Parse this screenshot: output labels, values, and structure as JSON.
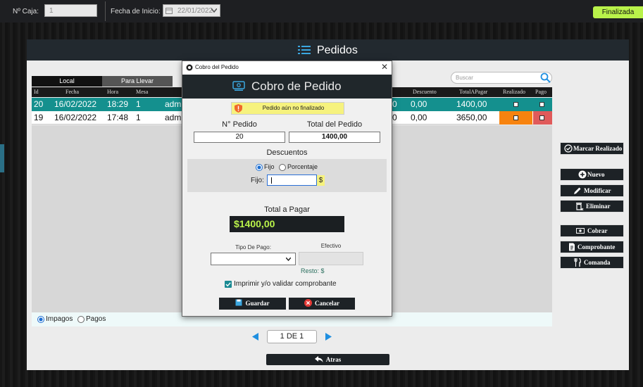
{
  "topbar": {
    "caja_label": "Nº Caja:",
    "caja_value": "1",
    "fecha_label": "Fecha de Inicio:",
    "fecha_value": "22/01/2022",
    "status_badge": "Finalizada"
  },
  "main": {
    "title": "Pedidos",
    "tabs": [
      {
        "label": "Local"
      },
      {
        "label": "Para Llevar"
      }
    ],
    "search_placeholder": "Buscar",
    "columns_left": [
      "Id",
      "Fecha",
      "Hora",
      "Mesa"
    ],
    "columns_right": [
      "Descuento",
      "TotalAPagar",
      "Realizado",
      "Pago"
    ],
    "rows": [
      {
        "id": "20",
        "fecha": "16/02/2022",
        "hora": "18:29",
        "mesa": "1",
        "user": "adm",
        "hidden_digit": "0",
        "descuento": "0,00",
        "total": "1400,00"
      },
      {
        "id": "19",
        "fecha": "16/02/2022",
        "hora": "17:48",
        "mesa": "1",
        "user": "adm",
        "hidden_digit": "0",
        "descuento": "0,00",
        "total": "3650,00"
      }
    ],
    "filter": {
      "impagos": "Impagos",
      "pagos": "Pagos"
    },
    "pagination": "1 DE 1",
    "back_button": "Atras"
  },
  "side_buttons": {
    "marcar": "Marcar Realizado",
    "nuevo": "Nuevo",
    "modificar": "Modificar",
    "eliminar": "Eliminar",
    "cobrar": "Cobrar",
    "comprobante": "Comprobante",
    "comanda": "Comanda"
  },
  "dialog": {
    "window_title": "Cobro del Pedido",
    "heading": "Cobro de Pedido",
    "warning": "Pedido aún no finalizado",
    "pedido_label": "N° Pedido",
    "pedido_value": "20",
    "total_label": "Total del Pedido",
    "total_value": "1400,00",
    "descuentos_label": "Descuentos",
    "opt_fijo": "Fijo",
    "opt_porcentaje": "Porcentaje",
    "fijo_label": "Fijo:",
    "currency": "$",
    "total_pagar_label": "Total a Pagar",
    "total_pagar_value": "$1400,00",
    "tipo_pago_label": "Tipo De Pago:",
    "efectivo_label": "Efectivo",
    "resto_label": "Resto: $",
    "imprimir_label": "Imprimir y/o validar comprobante",
    "guardar": "Guardar",
    "cancelar": "Cancelar"
  },
  "colors": {
    "accent_green": "#b9f24a",
    "row_selected": "#14908e",
    "realizado_orange": "#f7830f",
    "pago_red": "#e05a5a",
    "warning_yellow": "#f6f27e"
  }
}
